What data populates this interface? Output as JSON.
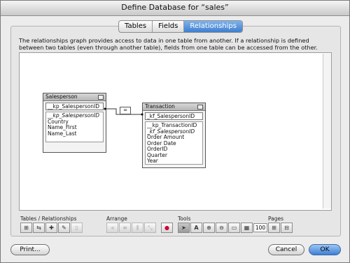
{
  "window": {
    "title": "Define Database for “sales”"
  },
  "tabs": [
    {
      "label": "Tables",
      "active": false
    },
    {
      "label": "Fields",
      "active": false
    },
    {
      "label": "Relationships",
      "active": true
    }
  ],
  "description": "The relationships graph provides access to data in one table from another. If a relationship is defined between two tables (even through another table), fields from one table can be accessed from the other.",
  "graph": {
    "tables": [
      {
        "name": "Salesperson",
        "key_field": "__kp_SalespersonID",
        "fields": [
          {
            "label": "__kp_SalespersonID",
            "italic": true
          },
          {
            "label": "Country",
            "italic": false
          },
          {
            "label": "Name_First",
            "italic": false
          },
          {
            "label": "Name_Last",
            "italic": false
          }
        ]
      },
      {
        "name": "Transaction",
        "key_field": "_kf_SalespersonID",
        "fields": [
          {
            "label": "__kp_TransactionID",
            "italic": false
          },
          {
            "label": "_kf_SalespersonID",
            "italic": true
          },
          {
            "label": "Order Amount",
            "italic": false
          },
          {
            "label": "Order Date",
            "italic": false
          },
          {
            "label": "OrderID",
            "italic": false
          },
          {
            "label": "Quarter",
            "italic": false
          },
          {
            "label": "Year",
            "italic": false
          }
        ]
      }
    ],
    "relationship_operator": "="
  },
  "toolbar": {
    "tables_relationships_label": "Tables / Relationships",
    "arrange_label": "Arrange",
    "tools_label": "Tools",
    "pages_label": "Pages",
    "zoom_value": "100",
    "zoom_unit": "%"
  },
  "buttons": {
    "print": "Print...",
    "cancel": "Cancel",
    "ok": "OK"
  },
  "colors": {
    "accent": "#3e7fd1",
    "selection_color": "#3b6aa8"
  }
}
